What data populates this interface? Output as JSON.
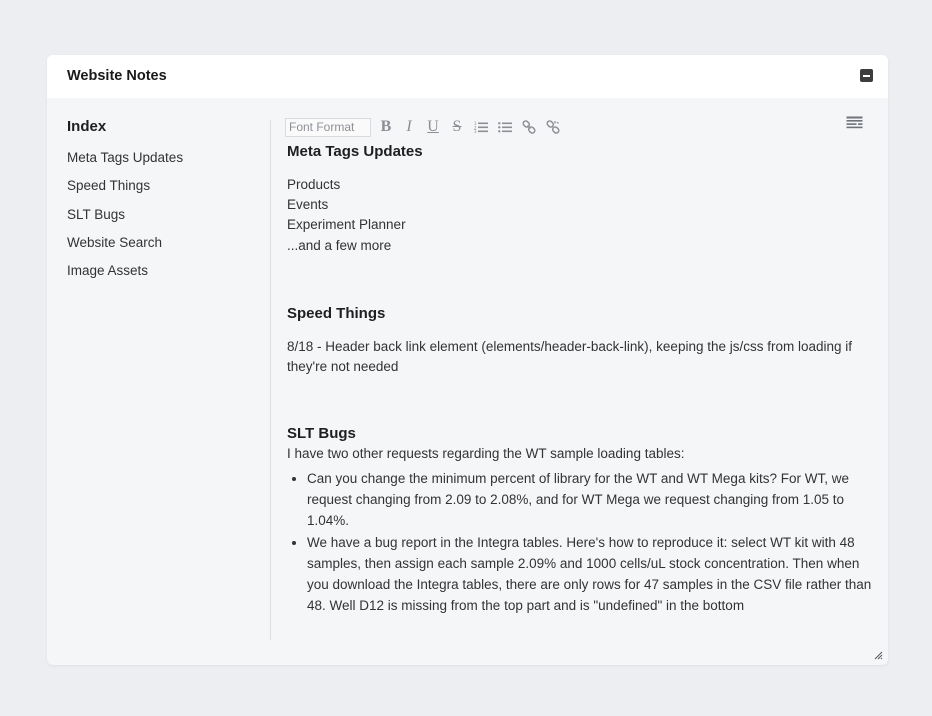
{
  "card": {
    "title": "Website Notes"
  },
  "sidebar": {
    "title": "Index",
    "items": [
      {
        "label": "Meta Tags Updates"
      },
      {
        "label": "Speed Things"
      },
      {
        "label": "SLT Bugs"
      },
      {
        "label": "Website Search"
      },
      {
        "label": "Image Assets"
      }
    ]
  },
  "toolbar": {
    "font_format_placeholder": "Font Format",
    "buttons": [
      {
        "icon": "bold-icon",
        "glyph": "B"
      },
      {
        "icon": "italic-icon",
        "glyph": "I"
      },
      {
        "icon": "underline-icon",
        "glyph": "U"
      },
      {
        "icon": "strikethrough-icon",
        "glyph": "S"
      },
      {
        "icon": "ordered-list-icon"
      },
      {
        "icon": "unordered-list-icon"
      },
      {
        "icon": "link-icon"
      },
      {
        "icon": "unlink-icon"
      }
    ]
  },
  "notes": {
    "meta": {
      "title": "Meta Tags Updates",
      "lines": [
        "Products",
        "Events",
        "Experiment Planner",
        "...and a few more"
      ]
    },
    "speed": {
      "title": "Speed Things",
      "text": "8/18 - Header back link element (elements/header-back-link), keeping the js/css from loading if they're not needed"
    },
    "slt": {
      "title": "SLT Bugs",
      "intro": "I have two other requests regarding the WT sample loading tables:",
      "bullets": [
        "Can you change the minimum percent of library for the WT and WT Mega kits? For WT, we request changing from 2.09 to 2.08%, and for WT Mega we request changing from 1.05 to 1.04%.",
        "We have a bug report in the Integra tables. Here's how to reproduce it: select WT kit with 48 samples, then assign each sample 2.09% and 1000 cells/uL stock concentration. Then when you download the Integra tables, there are only rows for 47 samples in the CSV file rather than 48. Well D12 is missing from the top part and is \"undefined\" in the bottom"
      ]
    }
  },
  "colors": {
    "background": "#eceef1",
    "card": "#f5f6f8",
    "header": "#ffffff",
    "icon": "#8b8f95"
  }
}
